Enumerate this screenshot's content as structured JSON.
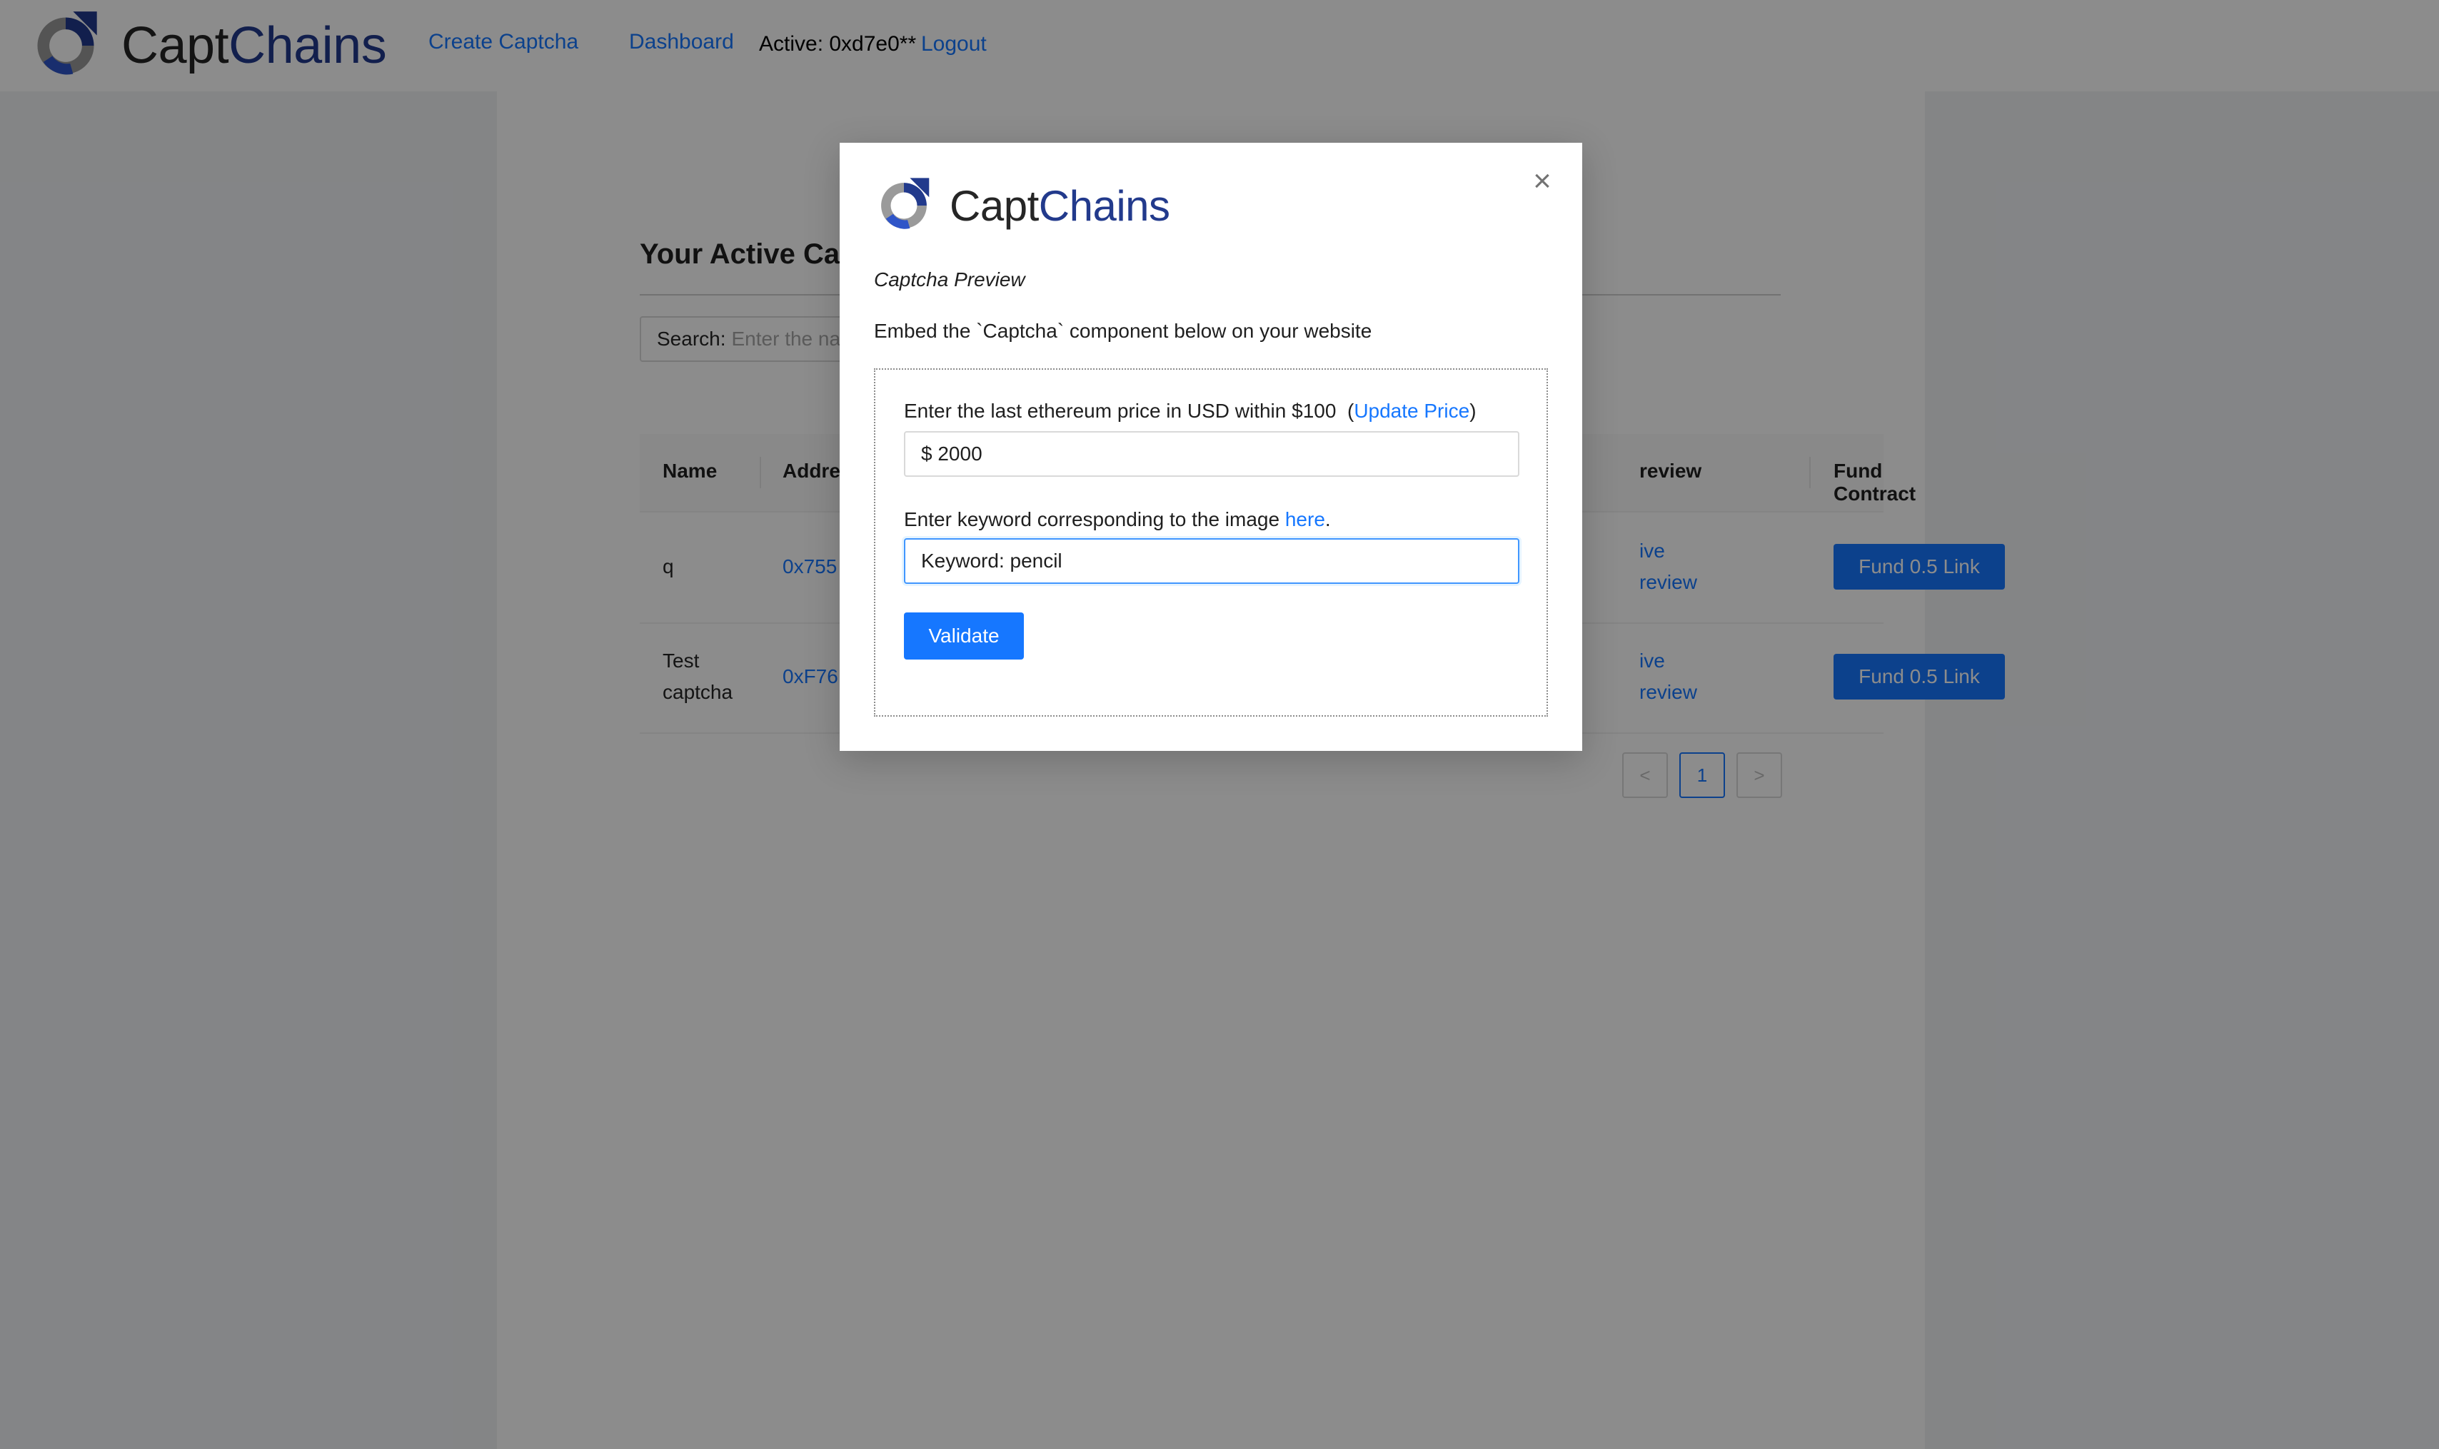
{
  "header": {
    "brand_capt": "Capt",
    "brand_chains": "Chains",
    "nav": {
      "create": "Create Captcha",
      "dashboard": "Dashboard"
    },
    "active_label": "Active: 0xd7e0**",
    "logout": "Logout"
  },
  "main": {
    "title": "Your Active Cap",
    "search": {
      "label": "Search:",
      "placeholder": "Enter the na"
    },
    "table": {
      "headers": {
        "name": "Name",
        "address": "Addre",
        "preview": "review",
        "fund": "Fund Contract"
      },
      "rows": [
        {
          "name": "q",
          "address": "0x755",
          "preview_line1": "ive",
          "preview_line2": "review",
          "fund": "Fund 0.5 Link"
        },
        {
          "name_line1": "Test",
          "name_line2": "captcha",
          "address": "0xF76",
          "preview_line1": "ive",
          "preview_line2": "review",
          "fund": "Fund 0.5 Link"
        }
      ]
    },
    "pagination": {
      "prev": "<",
      "current": "1",
      "next": ">"
    }
  },
  "modal": {
    "brand_capt": "Capt",
    "brand_chains": "Chains",
    "close": "×",
    "preview_title": "Captcha Preview",
    "embed_text": "Embed the `Captcha` component below on your website",
    "captcha": {
      "price_label": "Enter the last ethereum price in USD within $100",
      "price_paren_open": "(",
      "update_price_link": "Update Price",
      "price_paren_close": ")",
      "price_value": "$ 2000",
      "keyword_label": "Enter keyword corresponding to the image",
      "keyword_link": "here",
      "keyword_period": ".",
      "keyword_value": "Keyword: pencil",
      "validate": "Validate"
    }
  },
  "colors": {
    "brand_blue": "#223a8c",
    "link": "#1677ff",
    "primary": "#1677ff"
  },
  "icons": {
    "logo": "captchains-logo",
    "close": "close-icon",
    "prev": "chevron-left-icon",
    "next": "chevron-right-icon"
  }
}
